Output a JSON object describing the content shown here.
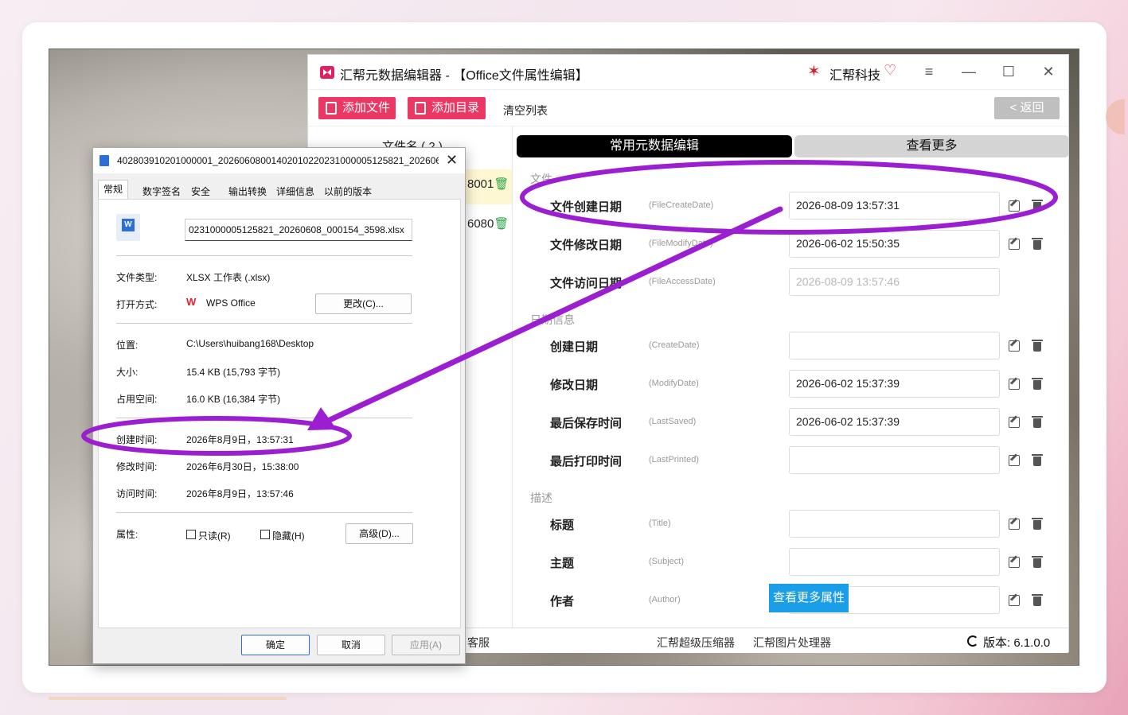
{
  "app": {
    "title": "汇帮元数据编辑器 - 【Office文件属性编辑】",
    "brand": "汇帮科技",
    "window_controls": [
      "≡",
      "—",
      "☐",
      "✕"
    ]
  },
  "toolbar": {
    "add_file": "添加文件",
    "add_folder": "添加目录",
    "clear_list": "清空列表",
    "back": "< 返回"
  },
  "filelist": {
    "header": "文件名 ( 2 )",
    "items": [
      {
        "suffix": "8001"
      },
      {
        "suffix": "6080"
      }
    ]
  },
  "tabs": {
    "common": "常用元数据编辑",
    "more": "查看更多"
  },
  "sections": {
    "file": "文件",
    "date_info": "日期信息",
    "description": "描述"
  },
  "rows": [
    {
      "label": "文件创建日期",
      "key": "(FileCreateDate)",
      "value": "2026-08-09 13:57:31"
    },
    {
      "label": "文件修改日期",
      "key": "(FileModifyDate)",
      "value": "2026-06-02 15:50:35"
    },
    {
      "label": "文件访问日期",
      "key": "(FileAccessDate)",
      "value": "2026-08-09 13:57:46"
    },
    {
      "label": "创建日期",
      "key": "(CreateDate)",
      "value": ""
    },
    {
      "label": "修改日期",
      "key": "(ModifyDate)",
      "value": "2026-06-02 15:37:39"
    },
    {
      "label": "最后保存时间",
      "key": "(LastSaved)",
      "value": "2026-06-02 15:37:39"
    },
    {
      "label": "最后打印时间",
      "key": "(LastPrinted)",
      "value": ""
    },
    {
      "label": "标题",
      "key": "(Title)",
      "value": ""
    },
    {
      "label": "主题",
      "key": "(Subject)",
      "value": ""
    },
    {
      "label": "作者",
      "key": "(Author)",
      "value": ""
    }
  ],
  "more_props_button": "查看更多属性",
  "statusbar": {
    "service": "客服",
    "compressor": "汇帮超级压缩器",
    "image_tool": "汇帮图片处理器",
    "version": "版本:  6.1.0.0"
  },
  "dialog": {
    "title": "402803910201000001_20260608001402010220231000005125821_202606...",
    "close": "✕",
    "tabs": [
      "常规",
      "数字签名",
      "安全",
      "输出转换",
      "详细信息",
      "以前的版本"
    ],
    "filename": "0231000005125821_20260608_000154_3598.xlsx",
    "file_type_label": "文件类型:",
    "file_type": "XLSX 工作表 (.xlsx)",
    "open_with_label": "打开方式:",
    "open_with": "WPS Office",
    "change_button": "更改(C)...",
    "location_label": "位置:",
    "location": "C:\\Users\\huibang168\\Desktop",
    "size_label": "大小:",
    "size": "15.4 KB (15,793 字节)",
    "disk_size_label": "占用空间:",
    "disk_size": "16.0 KB (16,384 字节)",
    "created_label": "创建时间:",
    "created": "2026年8月9日，13:57:31",
    "modified_label": "修改时间:",
    "modified": "2026年6月30日，15:38:00",
    "accessed_label": "访问时间:",
    "accessed": "2026年8月9日，13:57:46",
    "attributes_label": "属性:",
    "readonly": "只读(R)",
    "hidden": "隐藏(H)",
    "advanced_button": "高级(D)...",
    "ok": "确定",
    "cancel": "取消",
    "apply": "应用(A)"
  },
  "colors": {
    "accent_red": "#ea3763",
    "annotation_purple": "#9b1fd1",
    "blue_button": "#1a9ee8"
  }
}
